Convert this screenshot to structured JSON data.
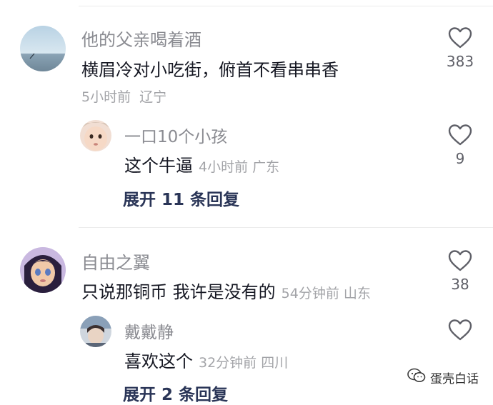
{
  "comments": [
    {
      "username": "他的父亲喝着酒",
      "text": "横眉冷对小吃街，俯首不看串串香",
      "time": "5小时前",
      "location": "辽宁",
      "likes": "383",
      "replies": [
        {
          "username": "一口10个小孩",
          "text": "这个牛逼",
          "time": "4小时前",
          "location": "广东",
          "likes": "9"
        }
      ],
      "expand_label": "展开 11 条回复"
    },
    {
      "username": "自由之翼",
      "text": "只说那铜币 我许是没有的",
      "time": "54分钟前",
      "location": "山东",
      "likes": "38",
      "replies": [
        {
          "username": "戴戴静",
          "text": "喜欢这个",
          "time": "32分钟前",
          "location": "四川",
          "likes": ""
        }
      ],
      "expand_label": "展开 2 条回复"
    }
  ],
  "watermark": "蛋壳白话",
  "icons": {
    "like": "heart-outline-icon",
    "watermark": "wechat-icon"
  },
  "colors": {
    "username": "#8a8b91",
    "meta": "#a3a4a8",
    "expand": "#2a3557"
  }
}
